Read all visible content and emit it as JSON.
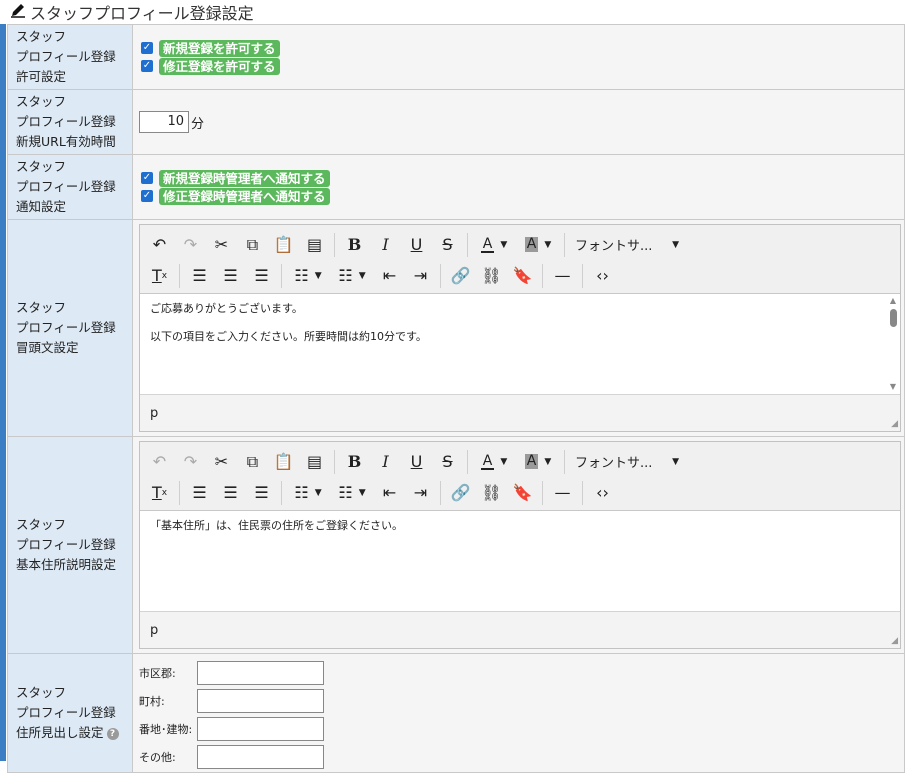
{
  "page_title": "スタッフプロフィール登録設定",
  "rows": {
    "permit": {
      "label": [
        "スタッフ",
        "プロフィール登録",
        "許可設定"
      ],
      "options": [
        "新規登録を許可する",
        "修正登録を許可する"
      ]
    },
    "url_expiry": {
      "label": [
        "スタッフ",
        "プロフィール登録",
        "新規URL有効時間"
      ],
      "value": "10",
      "unit": "分"
    },
    "notify": {
      "label": [
        "スタッフ",
        "プロフィール登録",
        "通知設定"
      ],
      "options": [
        "新規登録時管理者へ通知する",
        "修正登録時管理者へ通知する"
      ]
    },
    "intro": {
      "label": [
        "スタッフ",
        "プロフィール登録",
        "冒頭文設定"
      ],
      "content": [
        "ご応募ありがとうございます。",
        "以下の項目をご入力ください。所要時間は約10分です。"
      ],
      "status": "p"
    },
    "address_desc": {
      "label": [
        "スタッフ",
        "プロフィール登録",
        "基本住所説明設定"
      ],
      "content": [
        "「基本住所」は、住民票の住所をご登録ください。"
      ],
      "status": "p"
    },
    "address_headings": {
      "label": [
        "スタッフ",
        "プロフィール登録",
        "住所見出し設定"
      ],
      "fields": [
        "市区郡:",
        "町村:",
        "番地･建物:",
        "その他:"
      ]
    }
  },
  "editor_toolbar": {
    "font_size_label": "フォントサ..."
  },
  "colors": {
    "accent": "#3b7ec4",
    "label_bg": "#dde9f5",
    "pill_green": "#5cb85c",
    "checkbox_blue": "#1e6fd0"
  }
}
